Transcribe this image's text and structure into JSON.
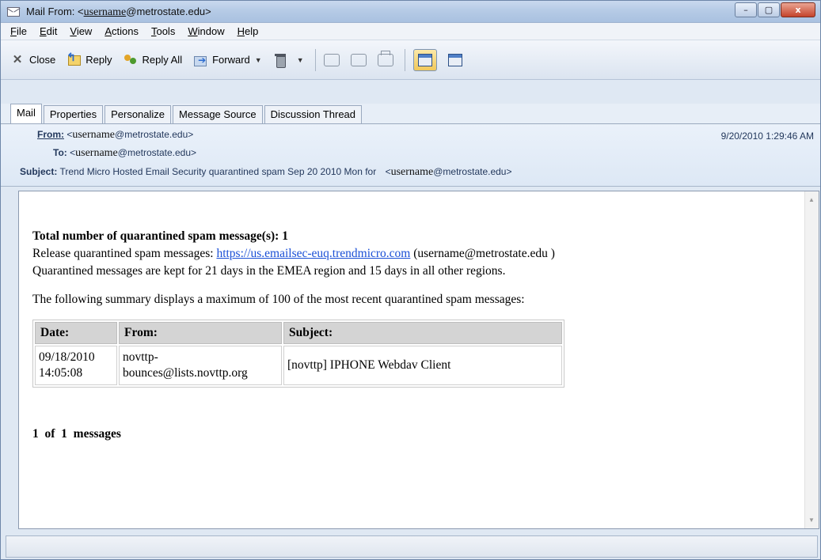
{
  "window": {
    "title_prefix": "Mail From: <",
    "title_user": "username",
    "title_suffix": "@metrostate.edu>",
    "minimize": "–",
    "maximize": "▢",
    "close": "x"
  },
  "menu": {
    "items": [
      {
        "key": "F",
        "rest": "ile"
      },
      {
        "key": "E",
        "rest": "dit"
      },
      {
        "key": "V",
        "rest": "iew"
      },
      {
        "key": "A",
        "rest": "ctions"
      },
      {
        "key": "T",
        "rest": "ools"
      },
      {
        "key": "W",
        "rest": "indow"
      },
      {
        "key": "H",
        "rest": "elp"
      }
    ]
  },
  "toolbar": {
    "close_label": "Close",
    "reply_label": "Reply",
    "reply_all_label": "Reply All",
    "forward_label": "Forward",
    "dropdown_glyph": "▼"
  },
  "tabs": [
    "Mail",
    "Properties",
    "Personalize",
    "Message Source",
    "Discussion Thread"
  ],
  "header": {
    "from_label": "From:",
    "from_prefix": "<",
    "from_user": "username",
    "from_domain": "@metrostate.edu>",
    "to_label": "To:",
    "to_prefix": "<",
    "to_user": "username",
    "to_domain": "@metrostate.edu>",
    "subject_label": "Subject:",
    "subject_text": "Trend Micro Hosted Email Security quarantined spam Sep 20 2010 Mon for",
    "subject_prefix": "<",
    "subject_user": "username",
    "subject_domain": "@metrostate.edu>",
    "date": "9/20/2010 1:29:46 AM"
  },
  "body": {
    "total_line": "Total number of quarantined spam message(s): 1",
    "release_prefix": "Release quarantined spam messages: ",
    "release_link": "https://us.emailsec-euq.trendmicro.com",
    "release_suffix": " (username@metrostate.edu )",
    "kept_line": "Quarantined messages are kept for 21 days in the EMEA region and 15 days in all other regions.",
    "summary_line": "The following summary displays a maximum of 100 of the most recent quarantined spam messages:",
    "table": {
      "headers": [
        "Date:",
        "From:",
        "Subject:"
      ],
      "rows": [
        {
          "date_line1": "09/18/2010",
          "date_line2": "14:05:08",
          "from_line1": "novttp-",
          "from_line2": "bounces@lists.novttp.org",
          "subject": "[novttp] IPHONE Webdav Client"
        }
      ]
    },
    "count_line": "1  of  1  messages"
  },
  "scrollbar": {
    "up": "▲",
    "down": "▼"
  },
  "colors": {
    "link": "#1a4fd6",
    "header_text": "#23385c",
    "table_header_bg": "#d4d4d4"
  }
}
